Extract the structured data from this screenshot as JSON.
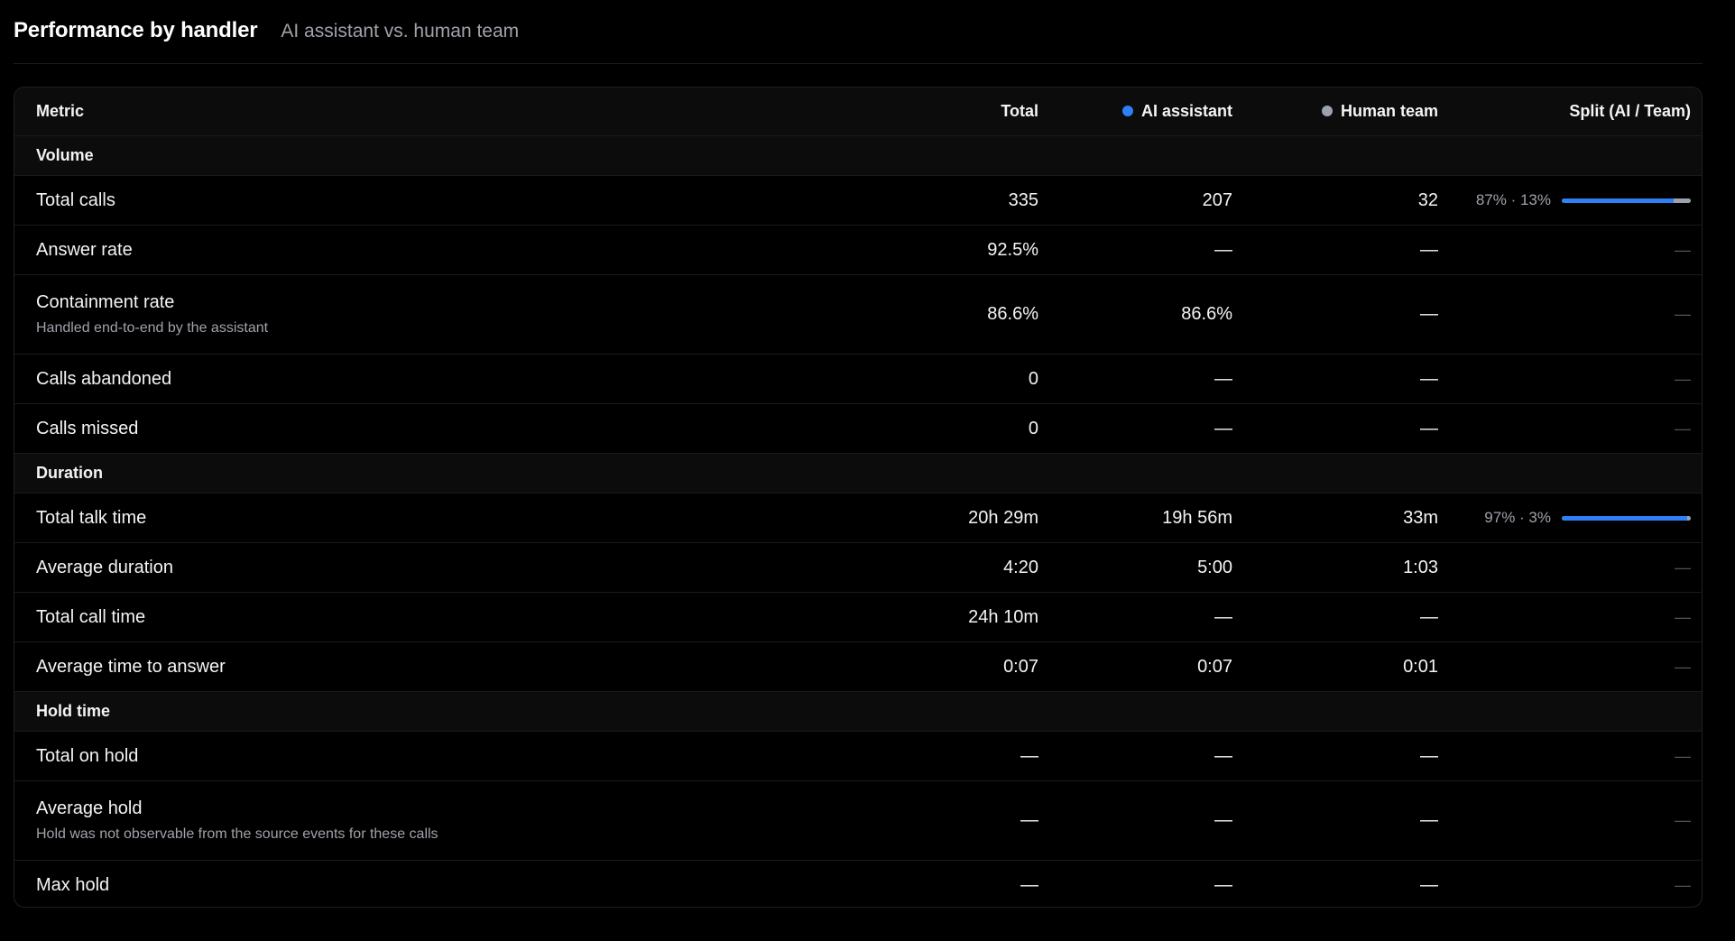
{
  "header": {
    "title": "Performance by handler",
    "subtitle": "AI assistant vs. human team"
  },
  "colors": {
    "ai": "#2f7ff5",
    "team": "#9ca3af",
    "background": "#000000"
  },
  "table": {
    "columns": {
      "metric": "Metric",
      "total": "Total",
      "ai": "AI assistant",
      "team": "Human team",
      "split": "Split (AI / Team)"
    },
    "sections": [
      {
        "label": "Volume",
        "rows": [
          {
            "label": "Total calls",
            "note": "",
            "total": "335",
            "ai": "207",
            "team": "32",
            "split_text": "87% · 13%",
            "split_ai": 0.87
          },
          {
            "label": "Answer rate",
            "note": "",
            "total": "92.5%",
            "ai": "—",
            "team": "—",
            "split_text": "—"
          },
          {
            "label": "Containment rate",
            "note": "Handled end-to-end by the assistant",
            "total": "86.6%",
            "ai": "86.6%",
            "team": "—",
            "split_text": "—"
          },
          {
            "label": "Calls abandoned",
            "note": "",
            "total": "0",
            "ai": "—",
            "team": "—",
            "split_text": "—"
          },
          {
            "label": "Calls missed",
            "note": "",
            "total": "0",
            "ai": "—",
            "team": "—",
            "split_text": "—"
          }
        ]
      },
      {
        "label": "Duration",
        "rows": [
          {
            "label": "Total talk time",
            "note": "",
            "total": "20h 29m",
            "ai": "19h 56m",
            "team": "33m",
            "split_text": "97% · 3%",
            "split_ai": 0.97
          },
          {
            "label": "Average duration",
            "note": "",
            "total": "4:20",
            "ai": "5:00",
            "team": "1:03",
            "split_text": "—"
          },
          {
            "label": "Total call time",
            "note": "",
            "total": "24h 10m",
            "ai": "—",
            "team": "—",
            "split_text": "—"
          },
          {
            "label": "Average time to answer",
            "note": "",
            "total": "0:07",
            "ai": "0:07",
            "team": "0:01",
            "split_text": "—"
          }
        ]
      },
      {
        "label": "Hold time",
        "rows": [
          {
            "label": "Total on hold",
            "note": "",
            "total": "—",
            "ai": "—",
            "team": "—",
            "split_text": "—"
          },
          {
            "label": "Average hold",
            "note": "Hold was not observable from the source events for these calls",
            "total": "—",
            "ai": "—",
            "team": "—",
            "split_text": "—"
          },
          {
            "label": "Max hold",
            "note": "",
            "total": "—",
            "ai": "—",
            "team": "—",
            "split_text": "—"
          }
        ]
      }
    ]
  }
}
